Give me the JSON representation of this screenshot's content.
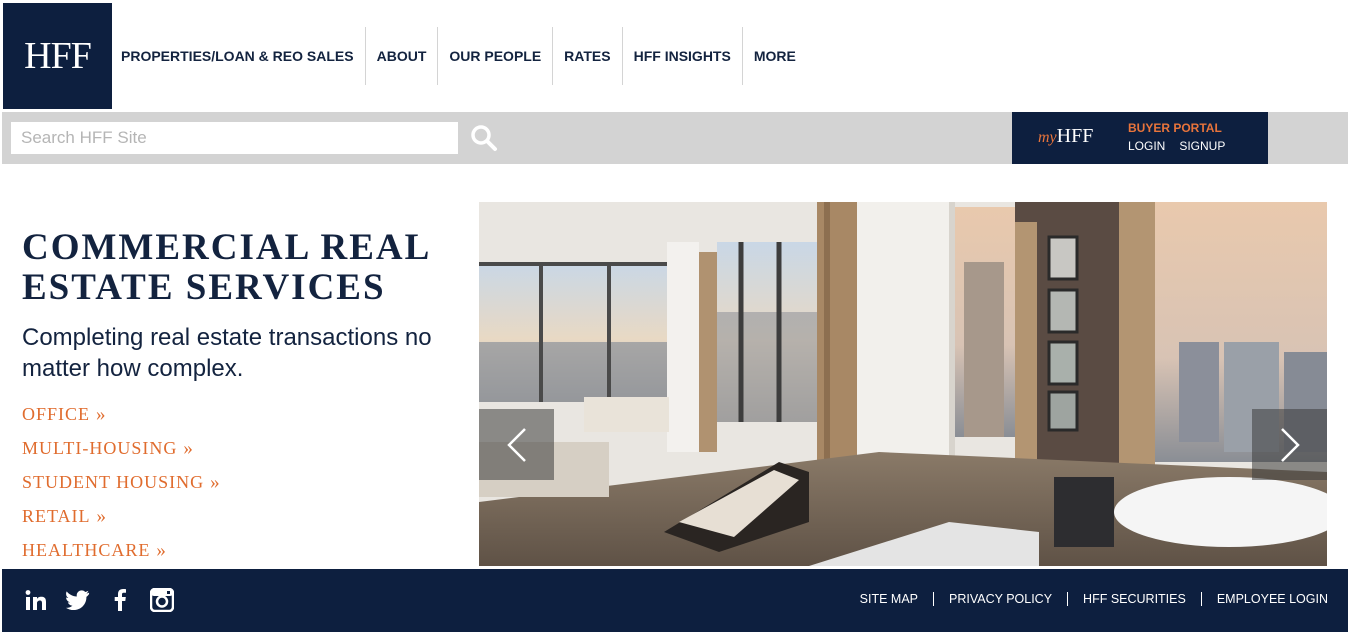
{
  "logo": {
    "text": "HFF"
  },
  "nav": [
    {
      "label": "PROPERTIES/LOAN & REO SALES"
    },
    {
      "label": "ABOUT"
    },
    {
      "label": "OUR PEOPLE"
    },
    {
      "label": "RATES"
    },
    {
      "label": "HFF INSIGHTS"
    },
    {
      "label": "MORE"
    }
  ],
  "search": {
    "placeholder": "Search HFF Site",
    "value": "",
    "icon": "search-icon"
  },
  "portal": {
    "logo_prefix": "my",
    "logo_main": "HFF",
    "title": "BUYER PORTAL",
    "login": "LOGIN",
    "signup": "SIGNUP"
  },
  "hero": {
    "title": "COMMERCIAL REAL ESTATE SERVICES",
    "subtitle": "Completing real estate transactions no matter how complex.",
    "services": [
      {
        "label": "OFFICE"
      },
      {
        "label": "MULTI-HOUSING"
      },
      {
        "label": "STUDENT HOUSING"
      },
      {
        "label": "RETAIL"
      },
      {
        "label": "HEALTHCARE"
      }
    ],
    "service_chevron": "»"
  },
  "carousel": {
    "prev_icon": "chevron-left-icon",
    "next_icon": "chevron-right-icon"
  },
  "footer": {
    "social": [
      "linkedin-icon",
      "twitter-icon",
      "facebook-icon",
      "instagram-icon"
    ],
    "links": [
      {
        "label": "SITE MAP"
      },
      {
        "label": "PRIVACY POLICY"
      },
      {
        "label": "HFF SECURITIES"
      },
      {
        "label": "EMPLOYEE LOGIN"
      }
    ]
  },
  "colors": {
    "navy": "#0d1f3f",
    "accent": "#e06c2e",
    "bar": "#d3d3d3"
  }
}
